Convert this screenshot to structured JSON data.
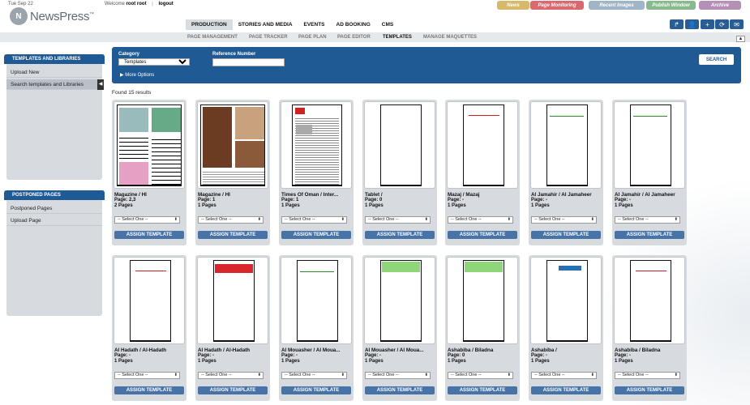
{
  "header": {
    "date": "Tue Sep 22",
    "logo_text": "NewsPress",
    "logo_mark": "™",
    "welcome_label": "Welcome",
    "user_name": "root root",
    "logout_label": "logout",
    "quick_links": [
      {
        "label": "News",
        "color": "#d7b96b"
      },
      {
        "label": "Page Monitoring",
        "color": "#d9686f"
      },
      {
        "label": "Recent Images",
        "color": "#9fb4c6"
      },
      {
        "label": "Publish Window",
        "color": "#88b98d"
      },
      {
        "label": "Archive",
        "color": "#b590b6"
      }
    ],
    "main_nav": [
      "PRODUCTION",
      "STORIES AND MEDIA",
      "EVENTS",
      "AD BOOKING",
      "CMS"
    ],
    "main_nav_active": "PRODUCTION",
    "sub_nav": [
      "PAGE MANAGEMENT",
      "PAGE TRACKER",
      "PAGE PLAN",
      "PAGE EDITOR",
      "TEMPLATES",
      "MANAGE MAQUETTES"
    ],
    "sub_nav_active": "TEMPLATES",
    "toolbar_icons": [
      "share-icon",
      "user-icon",
      "add-icon",
      "refresh-icon",
      "messages-icon"
    ]
  },
  "sidebar": {
    "templates_panel": {
      "title": "TEMPLATES AND LIBRARIES",
      "items": [
        "Upload New",
        "Search templates and Libraries"
      ]
    },
    "postponed_panel": {
      "title": "POSTPONED PAGES",
      "items": [
        "Postponed Pages",
        "Upload Page"
      ]
    }
  },
  "search": {
    "category_label": "Category",
    "category_value": "Templates",
    "reference_label": "Reference Number",
    "reference_value": "",
    "more_options_label": "More Options",
    "search_button": "SEARCH"
  },
  "results": {
    "found_text": "Found 15 results",
    "select_placeholder": "-- Select One --",
    "assign_label": "ASSIGN TEMPLATE",
    "cards": [
      {
        "title": "Magazine / HI",
        "pages_line": "Page: 2,3",
        "count_line": "2 Pages",
        "thumb": "spread-puzzle"
      },
      {
        "title": "Magazine / HI",
        "pages_line": "Page: 1",
        "count_line": "1 Pages",
        "thumb": "magazine-cover"
      },
      {
        "title": "Times Of Oman / Inter...",
        "pages_line": "Page: 1",
        "count_line": "1 Pages",
        "thumb": "newspaper"
      },
      {
        "title": "Tablet /",
        "pages_line": "Page: 0",
        "count_line": "1 Pages",
        "thumb": "blank"
      },
      {
        "title": "Mazaj / Mazaj",
        "pages_line": "Page: -",
        "count_line": "1 Pages",
        "thumb": "masthead-small"
      },
      {
        "title": "Al Jamahir / Al Jamaheer",
        "pages_line": "Page: -",
        "count_line": "1 Pages",
        "thumb": "masthead-green"
      },
      {
        "title": "Al Jamahir / Al Jamaheer",
        "pages_line": "Page: -",
        "count_line": "1 Pages",
        "thumb": "masthead-green"
      },
      {
        "title": "Al Hadath / Al-Hadath",
        "pages_line": "Page: -",
        "count_line": "1 Pages",
        "thumb": "masthead-small"
      },
      {
        "title": "Al Hadath / Al-Hadath",
        "pages_line": "Page: -",
        "count_line": "1 Pages",
        "thumb": "masthead-red-block"
      },
      {
        "title": "Al Mouasher / Al Moua...",
        "pages_line": "Page: -",
        "count_line": "1 Pages",
        "thumb": "masthead-green"
      },
      {
        "title": "Al Mouasher / Al Moua...",
        "pages_line": "Page: -",
        "count_line": "1 Pages",
        "thumb": "masthead-green-block"
      },
      {
        "title": "Ashabiba / Biladna",
        "pages_line": "Page: 0",
        "count_line": "1 Pages",
        "thumb": "masthead-green-block"
      },
      {
        "title": "Ashabiba /",
        "pages_line": "Page: -",
        "count_line": "1 Pages",
        "thumb": "masthead-blue"
      },
      {
        "title": "Ashabiba / Biladna",
        "pages_line": "Page: -",
        "count_line": "1 Pages",
        "thumb": "masthead-small"
      }
    ]
  }
}
